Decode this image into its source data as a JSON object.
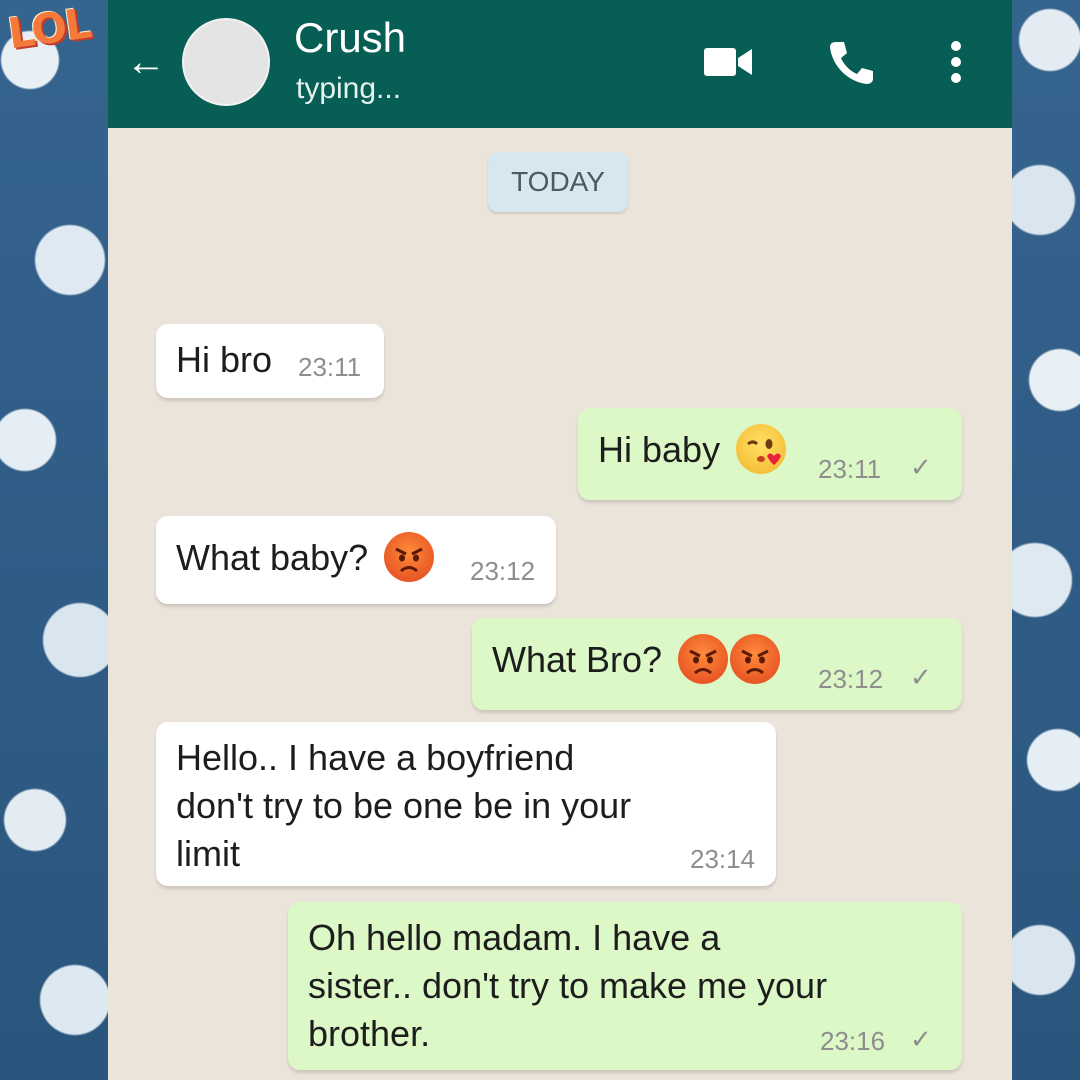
{
  "overlay": {
    "badge_text": "LOL"
  },
  "header": {
    "back_icon": "arrow-left-icon",
    "contact_name": "Crush",
    "status": "typing...",
    "actions": [
      "video-call-icon",
      "phone-icon",
      "more-vert-icon"
    ],
    "bar_color": "#075e54"
  },
  "chat": {
    "date_label": "TODAY",
    "messages": [
      {
        "direction": "incoming",
        "text": "Hi bro",
        "emoji": [],
        "time": "23:11"
      },
      {
        "direction": "outgoing",
        "text": "Hi baby",
        "emoji": [
          "kissing-winking-face"
        ],
        "time": "23:11",
        "status": "✓"
      },
      {
        "direction": "incoming",
        "text": "What baby?",
        "emoji": [
          "angry-face"
        ],
        "time": "23:12"
      },
      {
        "direction": "outgoing",
        "text": "What Bro?",
        "emoji": [
          "angry-face",
          "angry-face"
        ],
        "time": "23:12",
        "status": "✓"
      },
      {
        "direction": "incoming",
        "text": "Hello.. I have a boyfriend don't try to be one be in your limit",
        "emoji": [],
        "time": "23:14"
      },
      {
        "direction": "outgoing",
        "text": "Oh hello madam. I have a sister.. don't try to make me your brother.",
        "emoji": [],
        "time": "23:16",
        "status": "✓"
      }
    ],
    "colors": {
      "incoming_bubble": "#ffffff",
      "outgoing_bubble": "#dcf8c6",
      "wallpaper": "#ebe4da"
    }
  }
}
